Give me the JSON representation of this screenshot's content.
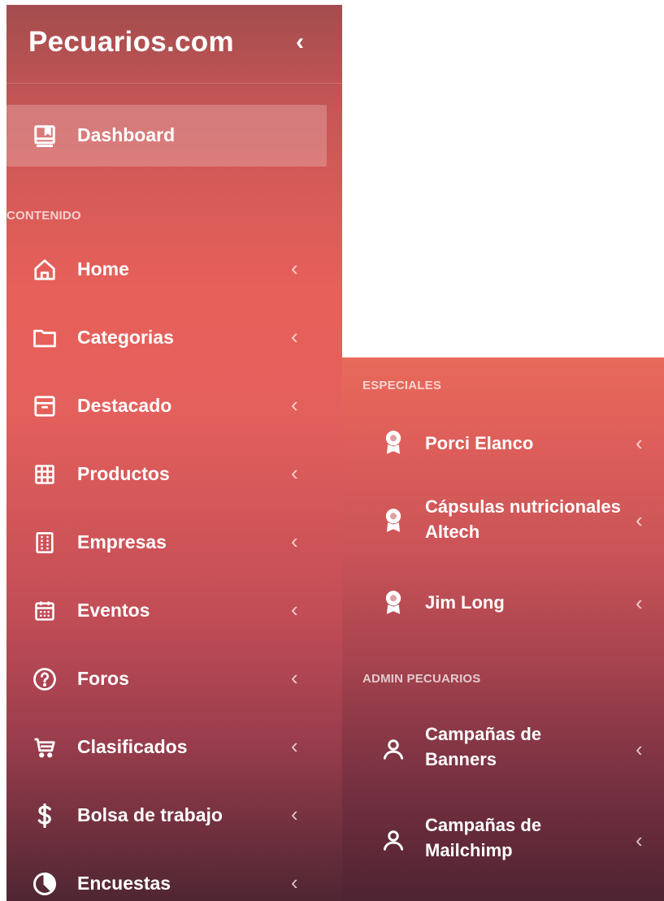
{
  "brand": {
    "title": "Pecuarios.com",
    "toggle": "‹"
  },
  "dashboard": {
    "label": "Dashboard"
  },
  "sections": {
    "contenido": "CONTENIDO",
    "especiales": "ESPECIALES",
    "admin": "ADMIN PECUARIOS"
  },
  "chevron": "‹",
  "menu": [
    {
      "label": "Home",
      "icon": "home-icon"
    },
    {
      "label": "Categorias",
      "icon": "folder-icon"
    },
    {
      "label": "Destacado",
      "icon": "archive-icon"
    },
    {
      "label": "Productos",
      "icon": "grid-icon"
    },
    {
      "label": "Empresas",
      "icon": "building-icon"
    },
    {
      "label": "Eventos",
      "icon": "calendar-icon"
    },
    {
      "label": "Foros",
      "icon": "help-circle-icon"
    },
    {
      "label": "Clasificados",
      "icon": "cart-icon"
    },
    {
      "label": "Bolsa de trabajo",
      "icon": "dollar-icon"
    },
    {
      "label": "Encuestas",
      "icon": "pie-chart-icon"
    }
  ],
  "especiales": [
    {
      "label": "Porci Elanco",
      "icon": "award-icon"
    },
    {
      "label": "Cápsulas nutricionales Altech",
      "icon": "award-icon"
    },
    {
      "label": "Jim Long",
      "icon": "award-icon"
    }
  ],
  "admin": [
    {
      "label": "Campañas de Banners",
      "icon": "user-icon"
    },
    {
      "label": "Campañas de Mailchimp",
      "icon": "user-icon"
    }
  ]
}
